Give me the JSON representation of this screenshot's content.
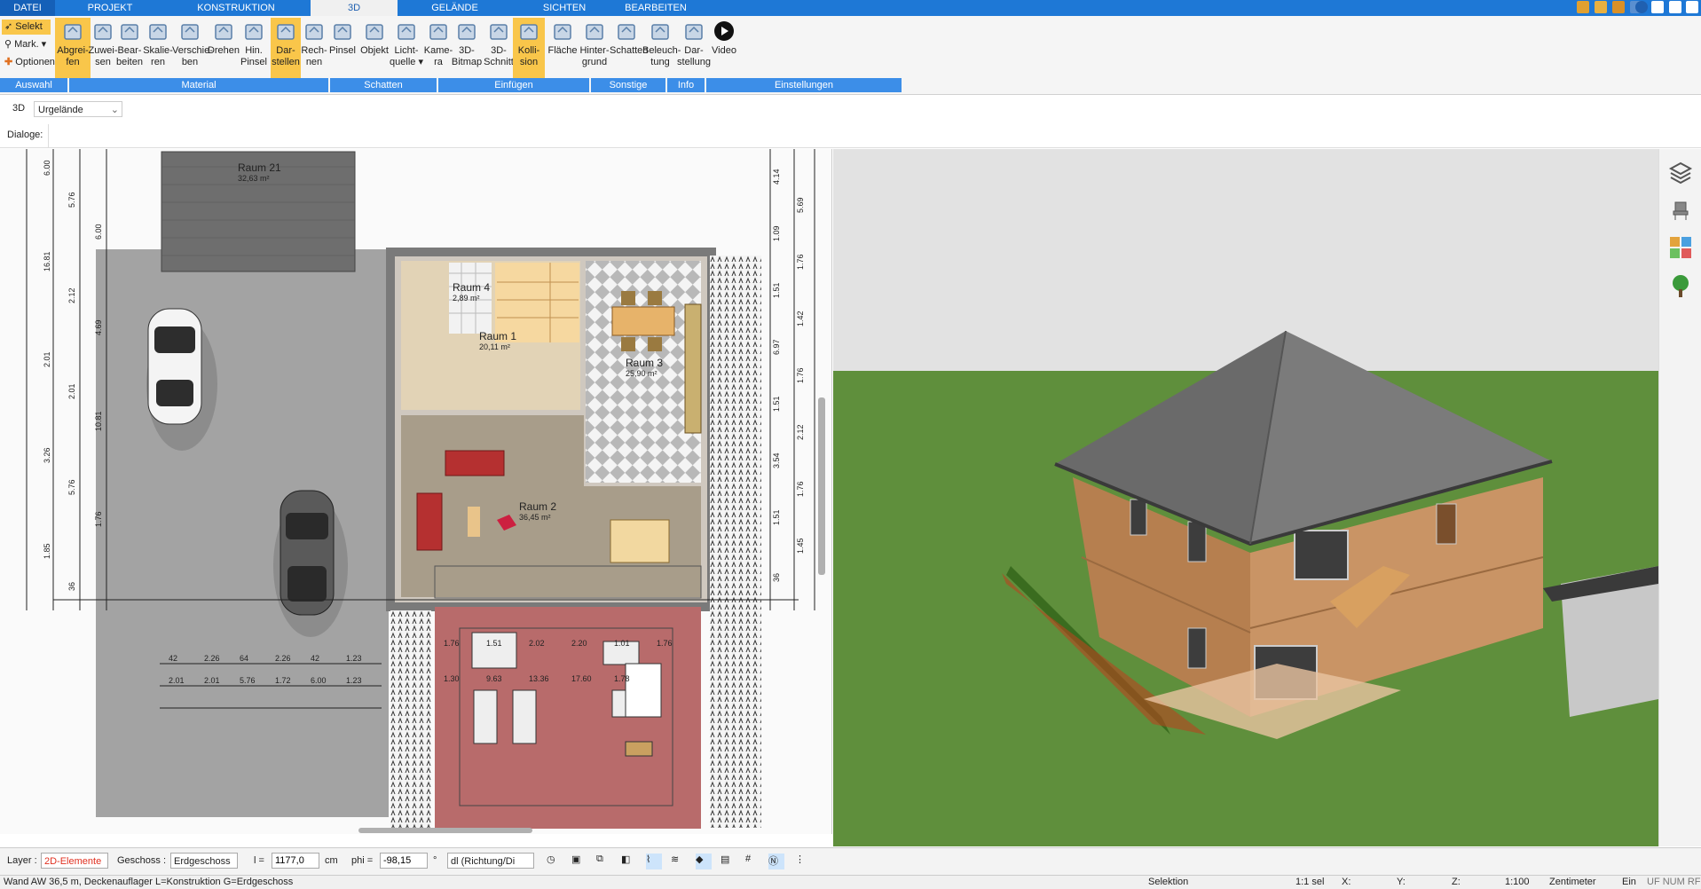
{
  "menu": {
    "tabs": [
      {
        "label": "DATEI"
      },
      {
        "label": "PROJEKT"
      },
      {
        "label": "KONSTRUKTION"
      },
      {
        "label": "3D"
      },
      {
        "label": "GELÄNDE"
      },
      {
        "label": "SICHTEN"
      },
      {
        "label": "BEARBEITEN"
      }
    ]
  },
  "ribbon": {
    "left": {
      "select": "Selekt",
      "mark": "Mark.",
      "options": "Optionen"
    },
    "buttons": [
      {
        "label": "Abgrei-\nfen"
      },
      {
        "label": "Zuwei-\nsen"
      },
      {
        "label": "Bear-\nbeiten"
      },
      {
        "label": "Skalie-\nren"
      },
      {
        "label": "Verschie-\nben"
      },
      {
        "label": "Drehen"
      },
      {
        "label": "Hin.\nPinsel"
      },
      {
        "label": "Dar-\nstellen"
      },
      {
        "label": "Rech-\nnen"
      },
      {
        "label": "Pinsel"
      },
      {
        "label": "Objekt"
      },
      {
        "label": "Licht-\nquelle ▾"
      },
      {
        "label": "Kame-\nra"
      },
      {
        "label": "3D-\nBitmap"
      },
      {
        "label": "3D-\nSchnitt"
      },
      {
        "label": "Kolli-\nsion"
      },
      {
        "label": "Fläche"
      },
      {
        "label": "Hinter-\ngrund"
      },
      {
        "label": "Schatten"
      },
      {
        "label": "Beleuch-\ntung"
      },
      {
        "label": "Dar-\nstellung"
      },
      {
        "label": "Video"
      }
    ],
    "groups": [
      {
        "label": "Auswahl"
      },
      {
        "label": "Material"
      },
      {
        "label": "Schatten"
      },
      {
        "label": "Einfügen"
      },
      {
        "label": "Sonstige"
      },
      {
        "label": "Info"
      },
      {
        "label": "Einstellungen"
      }
    ]
  },
  "row3d": {
    "prefix": "3D",
    "dropdown": "Urgelände"
  },
  "dialogs": {
    "label": "Dialoge:"
  },
  "plan": {
    "rooms": [
      {
        "name": "Raum 21",
        "area": "32,63 m²"
      },
      {
        "name": "Raum 4",
        "area": "2,89 m²"
      },
      {
        "name": "Raum 1",
        "area": "20,11 m²"
      },
      {
        "name": "Raum 3",
        "area": "25,90 m²"
      },
      {
        "name": "Raum 2",
        "area": "36,45 m²"
      }
    ],
    "dims_left": [
      "6.00",
      "5.76",
      "6.00",
      "16.81",
      "2.12",
      "4.69",
      "2.01",
      "2.01",
      "10.81",
      "3.26",
      "5.76",
      "1.76",
      "1.85",
      "36"
    ],
    "dims_right": [
      "4.14",
      "5.69",
      "1.09",
      "1.76",
      "1.51",
      "1.42",
      "6.97",
      "1.76",
      "1.51",
      "2.12",
      "3.54",
      "1.76",
      "1.51",
      "1.45",
      "36"
    ],
    "dims_bottom": [
      "42",
      "2.26",
      "64",
      "2.26",
      "42",
      "1.23",
      "2.01",
      "2.01",
      "5.76",
      "1.72",
      "6.00",
      "1.23"
    ],
    "dims_inner": [
      "1.76",
      "1.51",
      "2.02",
      "2.20",
      "1.01",
      "1.76",
      "1.30",
      "9.63",
      "13.36",
      "17.60",
      "1.78"
    ]
  },
  "bottom": {
    "layer_label": "Layer :",
    "layer_value": "2D-Elemente",
    "floor_label": "Geschoss :",
    "floor_value": "Erdgeschoss",
    "l_label": "l =",
    "l_value": "1177,0",
    "l_unit": "cm",
    "phi_label": "phi =",
    "phi_value": "-98,15",
    "phi_unit": "°",
    "dl_value": "dl (Richtung/Di"
  },
  "status": {
    "left": "Wand AW 36,5 m, Deckenauflager L=Konstruktion G=Erdgeschoss",
    "mode": "Selektion",
    "sel": "1:1 sel",
    "x": "X:",
    "y": "Y:",
    "z": "Z:",
    "scale": "1:100",
    "unit": "Zentimeter",
    "ein": "Ein",
    "flags": "UF NUM RF"
  },
  "colors": {
    "accent": "#1e78d6",
    "group": "#3c8ee8",
    "highlight": "#f9c64a"
  }
}
